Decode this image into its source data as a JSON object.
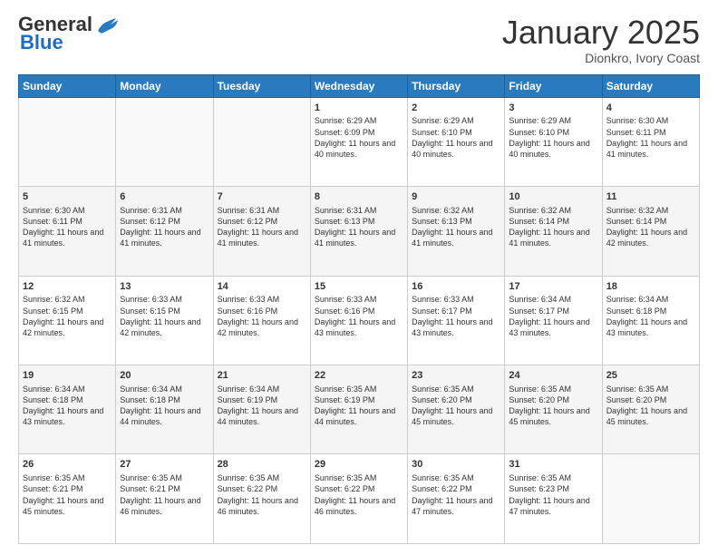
{
  "header": {
    "logo_general": "General",
    "logo_blue": "Blue",
    "month": "January 2025",
    "location": "Dionkro, Ivory Coast"
  },
  "weekdays": [
    "Sunday",
    "Monday",
    "Tuesday",
    "Wednesday",
    "Thursday",
    "Friday",
    "Saturday"
  ],
  "weeks": [
    [
      {
        "day": "",
        "sunrise": "",
        "sunset": "",
        "daylight": ""
      },
      {
        "day": "",
        "sunrise": "",
        "sunset": "",
        "daylight": ""
      },
      {
        "day": "",
        "sunrise": "",
        "sunset": "",
        "daylight": ""
      },
      {
        "day": "1",
        "sunrise": "6:29 AM",
        "sunset": "6:09 PM",
        "daylight": "11 hours and 40 minutes."
      },
      {
        "day": "2",
        "sunrise": "6:29 AM",
        "sunset": "6:10 PM",
        "daylight": "11 hours and 40 minutes."
      },
      {
        "day": "3",
        "sunrise": "6:29 AM",
        "sunset": "6:10 PM",
        "daylight": "11 hours and 40 minutes."
      },
      {
        "day": "4",
        "sunrise": "6:30 AM",
        "sunset": "6:11 PM",
        "daylight": "11 hours and 41 minutes."
      }
    ],
    [
      {
        "day": "5",
        "sunrise": "6:30 AM",
        "sunset": "6:11 PM",
        "daylight": "11 hours and 41 minutes."
      },
      {
        "day": "6",
        "sunrise": "6:31 AM",
        "sunset": "6:12 PM",
        "daylight": "11 hours and 41 minutes."
      },
      {
        "day": "7",
        "sunrise": "6:31 AM",
        "sunset": "6:12 PM",
        "daylight": "11 hours and 41 minutes."
      },
      {
        "day": "8",
        "sunrise": "6:31 AM",
        "sunset": "6:13 PM",
        "daylight": "11 hours and 41 minutes."
      },
      {
        "day": "9",
        "sunrise": "6:32 AM",
        "sunset": "6:13 PM",
        "daylight": "11 hours and 41 minutes."
      },
      {
        "day": "10",
        "sunrise": "6:32 AM",
        "sunset": "6:14 PM",
        "daylight": "11 hours and 41 minutes."
      },
      {
        "day": "11",
        "sunrise": "6:32 AM",
        "sunset": "6:14 PM",
        "daylight": "11 hours and 42 minutes."
      }
    ],
    [
      {
        "day": "12",
        "sunrise": "6:32 AM",
        "sunset": "6:15 PM",
        "daylight": "11 hours and 42 minutes."
      },
      {
        "day": "13",
        "sunrise": "6:33 AM",
        "sunset": "6:15 PM",
        "daylight": "11 hours and 42 minutes."
      },
      {
        "day": "14",
        "sunrise": "6:33 AM",
        "sunset": "6:16 PM",
        "daylight": "11 hours and 42 minutes."
      },
      {
        "day": "15",
        "sunrise": "6:33 AM",
        "sunset": "6:16 PM",
        "daylight": "11 hours and 43 minutes."
      },
      {
        "day": "16",
        "sunrise": "6:33 AM",
        "sunset": "6:17 PM",
        "daylight": "11 hours and 43 minutes."
      },
      {
        "day": "17",
        "sunrise": "6:34 AM",
        "sunset": "6:17 PM",
        "daylight": "11 hours and 43 minutes."
      },
      {
        "day": "18",
        "sunrise": "6:34 AM",
        "sunset": "6:18 PM",
        "daylight": "11 hours and 43 minutes."
      }
    ],
    [
      {
        "day": "19",
        "sunrise": "6:34 AM",
        "sunset": "6:18 PM",
        "daylight": "11 hours and 43 minutes."
      },
      {
        "day": "20",
        "sunrise": "6:34 AM",
        "sunset": "6:18 PM",
        "daylight": "11 hours and 44 minutes."
      },
      {
        "day": "21",
        "sunrise": "6:34 AM",
        "sunset": "6:19 PM",
        "daylight": "11 hours and 44 minutes."
      },
      {
        "day": "22",
        "sunrise": "6:35 AM",
        "sunset": "6:19 PM",
        "daylight": "11 hours and 44 minutes."
      },
      {
        "day": "23",
        "sunrise": "6:35 AM",
        "sunset": "6:20 PM",
        "daylight": "11 hours and 45 minutes."
      },
      {
        "day": "24",
        "sunrise": "6:35 AM",
        "sunset": "6:20 PM",
        "daylight": "11 hours and 45 minutes."
      },
      {
        "day": "25",
        "sunrise": "6:35 AM",
        "sunset": "6:20 PM",
        "daylight": "11 hours and 45 minutes."
      }
    ],
    [
      {
        "day": "26",
        "sunrise": "6:35 AM",
        "sunset": "6:21 PM",
        "daylight": "11 hours and 45 minutes."
      },
      {
        "day": "27",
        "sunrise": "6:35 AM",
        "sunset": "6:21 PM",
        "daylight": "11 hours and 46 minutes."
      },
      {
        "day": "28",
        "sunrise": "6:35 AM",
        "sunset": "6:22 PM",
        "daylight": "11 hours and 46 minutes."
      },
      {
        "day": "29",
        "sunrise": "6:35 AM",
        "sunset": "6:22 PM",
        "daylight": "11 hours and 46 minutes."
      },
      {
        "day": "30",
        "sunrise": "6:35 AM",
        "sunset": "6:22 PM",
        "daylight": "11 hours and 47 minutes."
      },
      {
        "day": "31",
        "sunrise": "6:35 AM",
        "sunset": "6:23 PM",
        "daylight": "11 hours and 47 minutes."
      },
      {
        "day": "",
        "sunrise": "",
        "sunset": "",
        "daylight": ""
      }
    ]
  ]
}
